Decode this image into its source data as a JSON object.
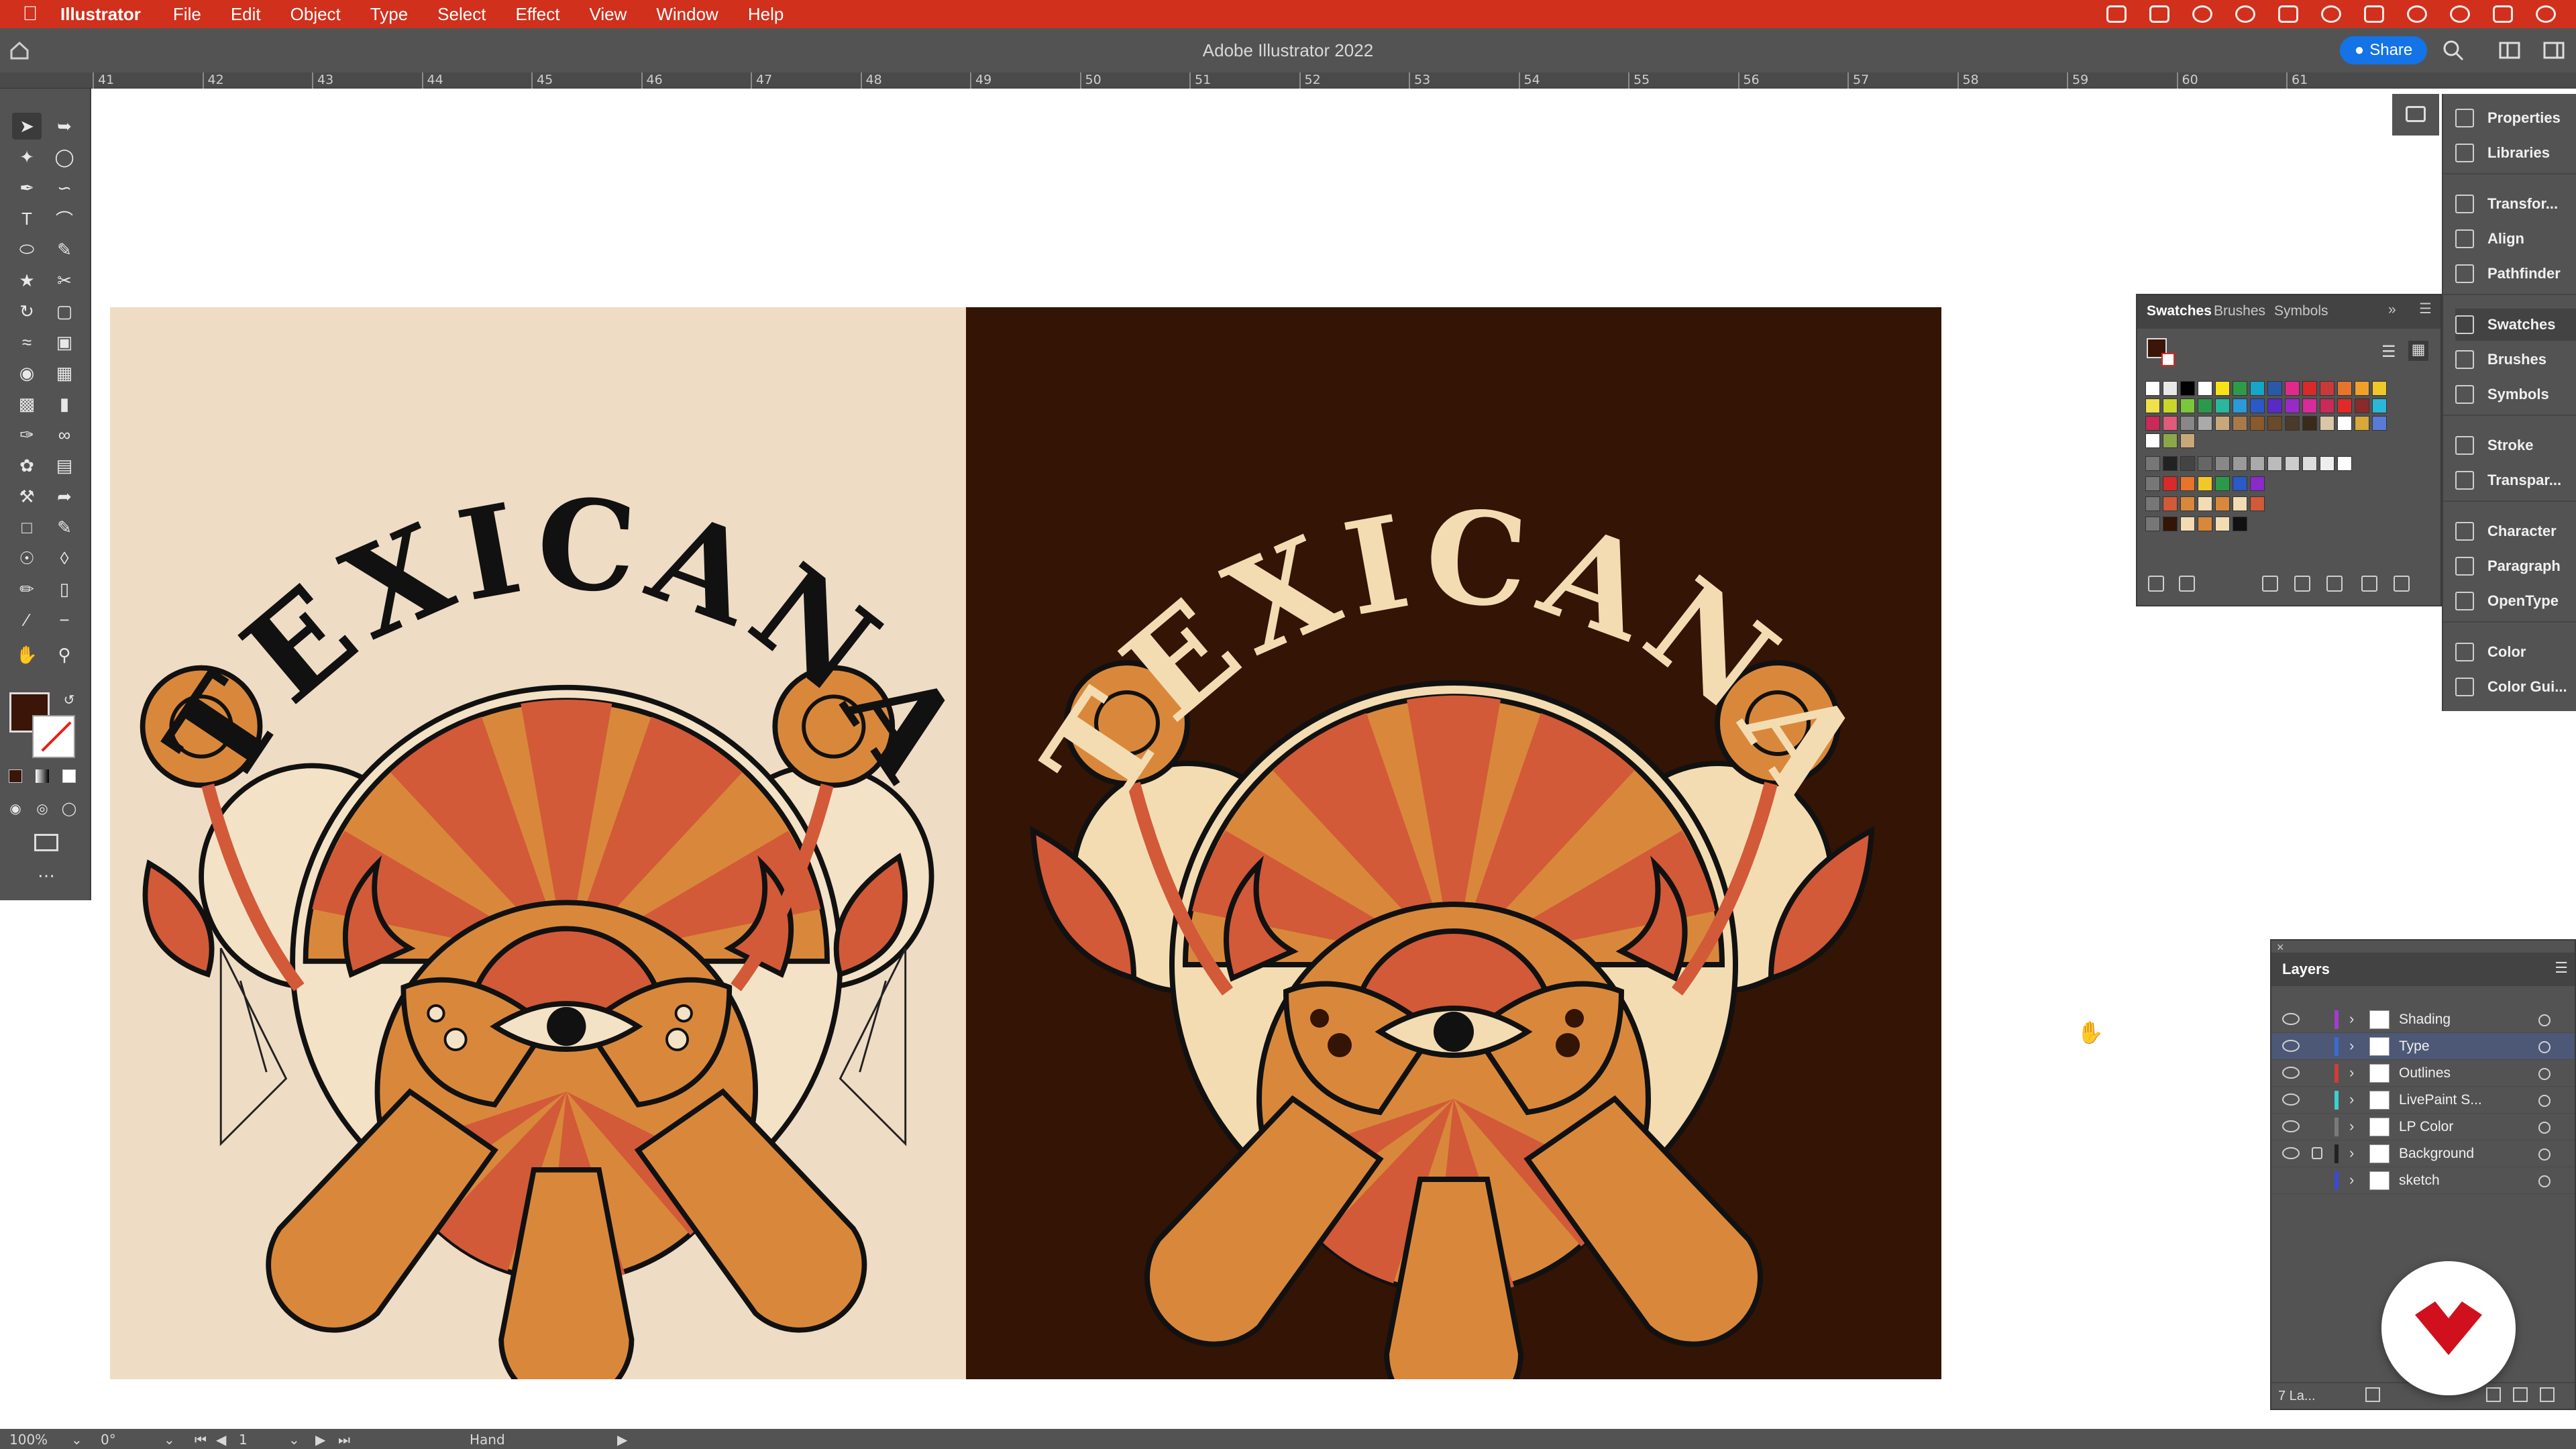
{
  "menubar": {
    "app_name": "Illustrator",
    "items": [
      "File",
      "Edit",
      "Object",
      "Type",
      "Select",
      "Effect",
      "View",
      "Window",
      "Help"
    ]
  },
  "titlebar": {
    "title": "Adobe Illustrator 2022",
    "share_label": "Share"
  },
  "ruler": {
    "ticks": [
      "41",
      "42",
      "43",
      "44",
      "45",
      "46",
      "47",
      "48",
      "49",
      "50",
      "51",
      "52",
      "53",
      "54",
      "55",
      "56",
      "57",
      "58",
      "59",
      "60",
      "61"
    ]
  },
  "artwork": {
    "left_title": "TEXICANA",
    "right_title": "TEXICANA"
  },
  "colors": {
    "menubar": "#d0301c",
    "panel": "#535353",
    "artboard_left_bg": "#efdcc4",
    "artboard_right_bg": "#341405",
    "orange": "#d9883b",
    "red": "#d25a38",
    "cream": "#f4dcb2",
    "accent_blue": "#1473e6"
  },
  "dock": {
    "items": [
      "Properties",
      "Libraries",
      "Transfor...",
      "Align",
      "Pathfinder",
      "Swatches",
      "Brushes",
      "Symbols",
      "Stroke",
      "Transpar...",
      "Character",
      "Paragraph",
      "OpenType",
      "Color",
      "Color Gui..."
    ]
  },
  "swatches_panel": {
    "tabs": [
      "Swatches",
      "Brushes",
      "Symbols"
    ]
  },
  "layers_panel": {
    "title": "Layers",
    "count_label": "7 La...",
    "layers": [
      {
        "name": "Shading",
        "color": "#a33cd0"
      },
      {
        "name": "Type",
        "color": "#3c6ad0"
      },
      {
        "name": "Outlines",
        "color": "#d03c3c"
      },
      {
        "name": "LivePaint S...",
        "color": "#3cd0d0"
      },
      {
        "name": "LP Color",
        "color": "#7a7a7a"
      },
      {
        "name": "Background",
        "color": "#222222"
      },
      {
        "name": "sketch",
        "color": "#3c4ad0"
      }
    ]
  },
  "statusbar": {
    "zoom": "100%",
    "rotation": "0°",
    "artboard_number": "1",
    "tool": "Hand"
  }
}
